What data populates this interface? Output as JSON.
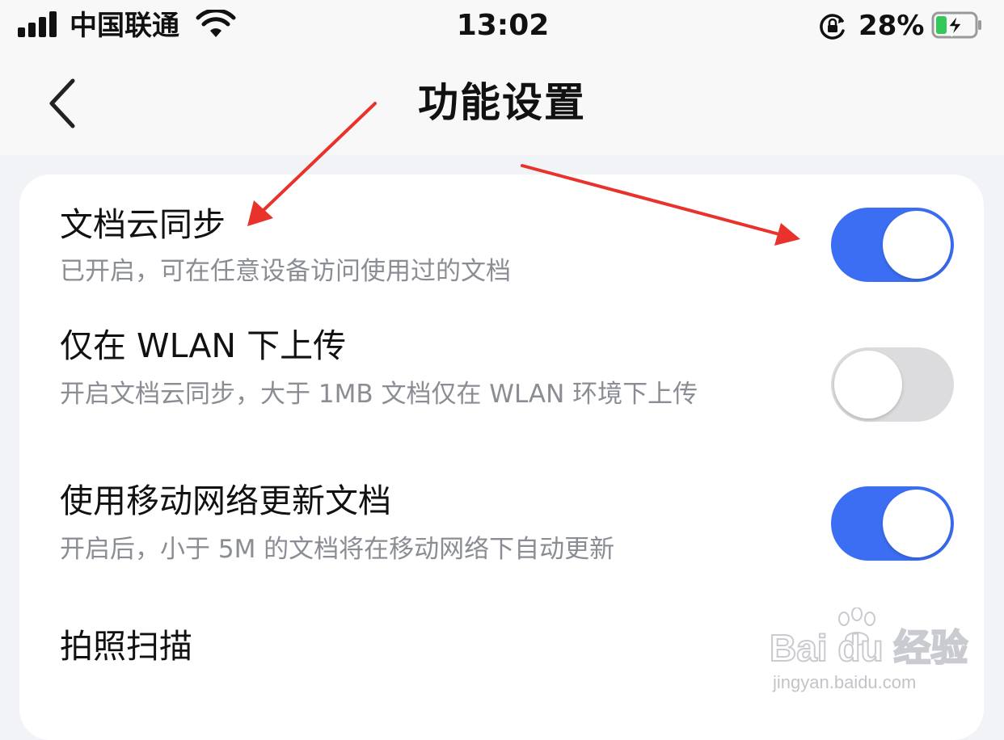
{
  "status_bar": {
    "carrier": "中国联通",
    "time": "13:02",
    "battery_percent": "28%",
    "battery_level": 0.28,
    "icons": [
      "signal-icon",
      "wifi-icon",
      "rotation-lock-icon",
      "battery-charging-icon"
    ]
  },
  "nav": {
    "title": "功能设置",
    "back_icon": "chevron-left-icon"
  },
  "settings": [
    {
      "title": "文档云同步",
      "description": "已开启，可在任意设备访问使用过的文档",
      "enabled": true
    },
    {
      "title": "仅在 WLAN 下上传",
      "description": "开启文档云同步，大于 1MB 文档仅在 WLAN 环境下上传",
      "enabled": false
    },
    {
      "title": "使用移动网络更新文档",
      "description": "开启后，小于 5M 的文档将在移动网络下自动更新",
      "enabled": true
    },
    {
      "title": "拍照扫描",
      "description": "",
      "enabled": null
    }
  ],
  "watermark": {
    "logo": "Bai du 经验",
    "url": "jingyan.baidu.com"
  },
  "colors": {
    "toggle_on": "#3b6ef2",
    "toggle_off": "#dcdcde",
    "annotation_arrow": "#e8322b",
    "background": "#f2f3f6",
    "card": "#ffffff"
  }
}
